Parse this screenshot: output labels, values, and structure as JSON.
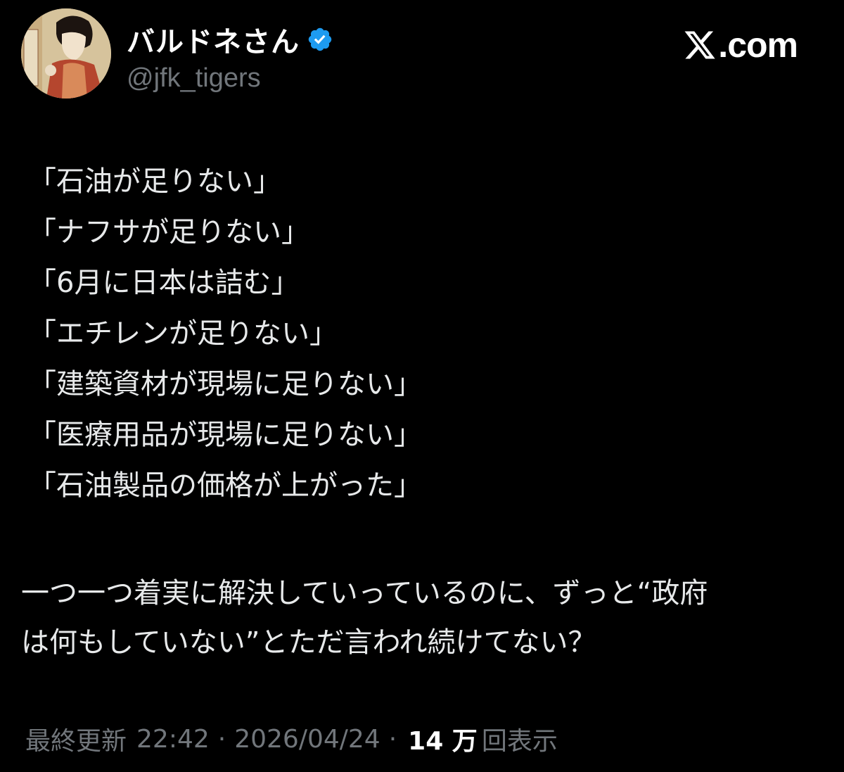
{
  "author": {
    "display_name": "バルドネさん",
    "handle": "@jfk_tigers",
    "verified": true
  },
  "brand": {
    "domain": ".com",
    "icon": "x-logo-icon"
  },
  "post": {
    "quotes": [
      "「石油が足りない」",
      "「ナフサが足りない」",
      "「6月に日本は詰む」",
      "「エチレンが足りない」",
      "「建築資材が現場に足りない」",
      "「医療用品が現場に足りない」",
      "「石油製品の価格が上がった」"
    ],
    "body_lines": [
      "一つ一つ着実に解決していっているのに、ずっと“政府",
      "は何もしていない”とただ言われ続けてない？"
    ]
  },
  "meta": {
    "updated_label": "最終更新",
    "time": "22:42",
    "separator": "·",
    "date": "2026/04/24",
    "views_count": "14 万",
    "views_label": "回表示"
  },
  "colors": {
    "background": "#000000",
    "text": "#e7e9ea",
    "muted": "#71767b",
    "verified": "#1d9bf0"
  }
}
